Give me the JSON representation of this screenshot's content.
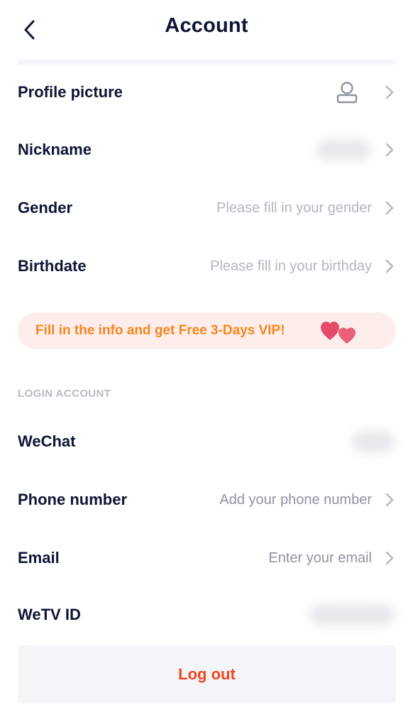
{
  "header": {
    "title": "Account",
    "back_icon": "chevron-left-icon"
  },
  "profile": {
    "rows": [
      {
        "label": "Profile picture",
        "value": "",
        "icon": "user-avatar-icon"
      },
      {
        "label": "Nickname",
        "value": ""
      },
      {
        "label": "Gender",
        "value": "Please fill in your gender"
      },
      {
        "label": "Birthdate",
        "value": "Please fill in your birthday"
      }
    ]
  },
  "vip_banner": {
    "text": "Fill in the info and get Free 3-Days VIP!",
    "icon": "hearts-icon",
    "color": "#f7861e",
    "background": "#fdeeeb"
  },
  "login_section": {
    "header": "LOGIN ACCOUNT",
    "rows": [
      {
        "label": "WeChat",
        "value": ""
      },
      {
        "label": "Phone number",
        "value": "Add your phone number"
      },
      {
        "label": "Email",
        "value": "Enter your email"
      },
      {
        "label": "WeTV ID",
        "value": ""
      }
    ]
  },
  "logout": {
    "label": "Log out",
    "color": "#f0451f"
  },
  "colors": {
    "primary_text": "#0f1535",
    "placeholder_text": "#b3b6c4",
    "accent_red": "#f0451f",
    "accent_orange": "#f7861e",
    "heart_pink": "#e64b6a"
  }
}
